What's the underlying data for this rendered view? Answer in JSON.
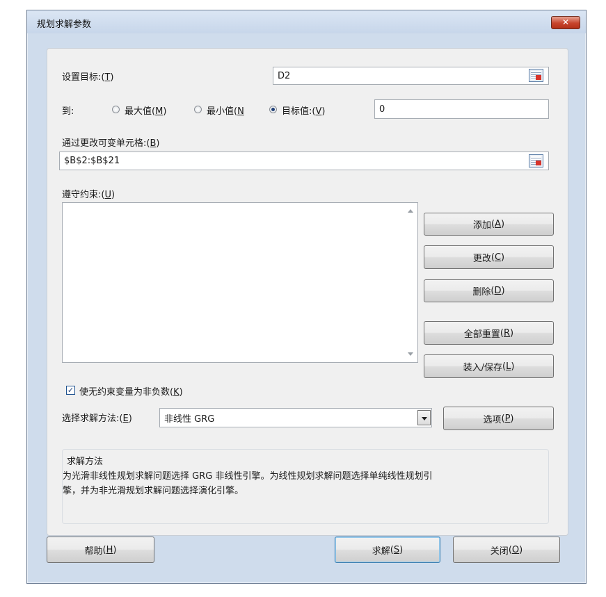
{
  "window": {
    "title": "规划求解参数",
    "close_glyph": "✕"
  },
  "objective": {
    "label": "设置目标:",
    "hotkey": "T",
    "value": "D2"
  },
  "to": {
    "label": "到:",
    "options": [
      {
        "label": "最大值",
        "hotkey": "M",
        "selected": false
      },
      {
        "label": "最小值",
        "hotkey": "N",
        "selected": false
      },
      {
        "label": "目标值:",
        "hotkey": "V",
        "selected": true
      }
    ],
    "value_of": "0"
  },
  "changing_cells": {
    "label": "通过更改可变单元格:",
    "hotkey": "B",
    "value": "$B$2:$B$21"
  },
  "constraints": {
    "label": "遵守约束:",
    "hotkey": "U",
    "items": [],
    "buttons": [
      {
        "label": "添加",
        "hotkey": "A"
      },
      {
        "label": "更改",
        "hotkey": "C"
      },
      {
        "label": "删除",
        "hotkey": "D"
      },
      {
        "label": "全部重置",
        "hotkey": "R"
      },
      {
        "label": "装入/保存",
        "hotkey": "L"
      }
    ]
  },
  "nonneg": {
    "label": "使无约束变量为非负数",
    "hotkey": "K",
    "checked": true
  },
  "method": {
    "label": "选择求解方法:",
    "hotkey": "E",
    "value": "非线性 GRG",
    "options_button": {
      "label": "选项",
      "hotkey": "P"
    }
  },
  "method_info": {
    "title": "求解方法",
    "line1": "为光滑非线性规划求解问题选择 GRG 非线性引擎。为线性规划求解问题选择单纯线性规划引",
    "line2": "擎，并为非光滑规划求解问题选择演化引擎。"
  },
  "footer": {
    "help": {
      "label": "帮助",
      "hotkey": "H"
    },
    "solve": {
      "label": "求解",
      "hotkey": "S"
    },
    "close": {
      "label": "关闭",
      "hotkey": "O"
    }
  },
  "colors": {
    "titlebar": "#cfdcec",
    "close": "#c7442c",
    "panel": "#f0f0f0"
  }
}
